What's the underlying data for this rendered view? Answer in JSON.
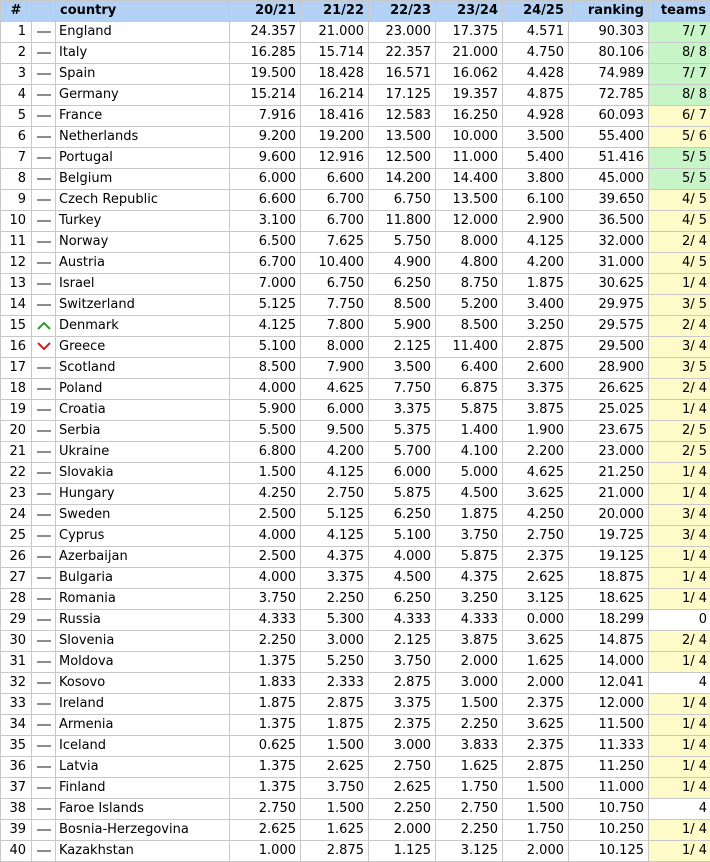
{
  "headers": {
    "num": "#",
    "country": "country",
    "s1": "20/21",
    "s2": "21/22",
    "s3": "22/23",
    "s4": "23/24",
    "s5": "24/25",
    "ranking": "ranking",
    "teams": "teams"
  },
  "colors": {
    "header_bg": "#b3d1f4",
    "teams_green": "#c8f5c8",
    "teams_yellow": "#fffbc8",
    "trend_same": "#8c8c8c",
    "trend_up": "#2e9a2e",
    "trend_down": "#cc2222"
  },
  "rows": [
    {
      "num": "1",
      "trend": "same",
      "country": "England",
      "v": [
        "24.357",
        "21.000",
        "23.000",
        "17.375",
        "4.571"
      ],
      "ranking": "90.303",
      "teams": "7/ 7",
      "teams_color": "green"
    },
    {
      "num": "2",
      "trend": "same",
      "country": "Italy",
      "v": [
        "16.285",
        "15.714",
        "22.357",
        "21.000",
        "4.750"
      ],
      "ranking": "80.106",
      "teams": "8/ 8",
      "teams_color": "green"
    },
    {
      "num": "3",
      "trend": "same",
      "country": "Spain",
      "v": [
        "19.500",
        "18.428",
        "16.571",
        "16.062",
        "4.428"
      ],
      "ranking": "74.989",
      "teams": "7/ 7",
      "teams_color": "green"
    },
    {
      "num": "4",
      "trend": "same",
      "country": "Germany",
      "v": [
        "15.214",
        "16.214",
        "17.125",
        "19.357",
        "4.875"
      ],
      "ranking": "72.785",
      "teams": "8/ 8",
      "teams_color": "green"
    },
    {
      "num": "5",
      "trend": "same",
      "country": "France",
      "v": [
        "7.916",
        "18.416",
        "12.583",
        "16.250",
        "4.928"
      ],
      "ranking": "60.093",
      "teams": "6/ 7",
      "teams_color": "yellow"
    },
    {
      "num": "6",
      "trend": "same",
      "country": "Netherlands",
      "v": [
        "9.200",
        "19.200",
        "13.500",
        "10.000",
        "3.500"
      ],
      "ranking": "55.400",
      "teams": "5/ 6",
      "teams_color": "yellow"
    },
    {
      "num": "7",
      "trend": "same",
      "country": "Portugal",
      "v": [
        "9.600",
        "12.916",
        "12.500",
        "11.000",
        "5.400"
      ],
      "ranking": "51.416",
      "teams": "5/ 5",
      "teams_color": "green"
    },
    {
      "num": "8",
      "trend": "same",
      "country": "Belgium",
      "v": [
        "6.000",
        "6.600",
        "14.200",
        "14.400",
        "3.800"
      ],
      "ranking": "45.000",
      "teams": "5/ 5",
      "teams_color": "green"
    },
    {
      "num": "9",
      "trend": "same",
      "country": "Czech Republic",
      "v": [
        "6.600",
        "6.700",
        "6.750",
        "13.500",
        "6.100"
      ],
      "ranking": "39.650",
      "teams": "4/ 5",
      "teams_color": "yellow"
    },
    {
      "num": "10",
      "trend": "same",
      "country": "Turkey",
      "v": [
        "3.100",
        "6.700",
        "11.800",
        "12.000",
        "2.900"
      ],
      "ranking": "36.500",
      "teams": "4/ 5",
      "teams_color": "yellow"
    },
    {
      "num": "11",
      "trend": "same",
      "country": "Norway",
      "v": [
        "6.500",
        "7.625",
        "5.750",
        "8.000",
        "4.125"
      ],
      "ranking": "32.000",
      "teams": "2/ 4",
      "teams_color": "yellow"
    },
    {
      "num": "12",
      "trend": "same",
      "country": "Austria",
      "v": [
        "6.700",
        "10.400",
        "4.900",
        "4.800",
        "4.200"
      ],
      "ranking": "31.000",
      "teams": "4/ 5",
      "teams_color": "yellow"
    },
    {
      "num": "13",
      "trend": "same",
      "country": "Israel",
      "v": [
        "7.000",
        "6.750",
        "6.250",
        "8.750",
        "1.875"
      ],
      "ranking": "30.625",
      "teams": "1/ 4",
      "teams_color": "yellow"
    },
    {
      "num": "14",
      "trend": "same",
      "country": "Switzerland",
      "v": [
        "5.125",
        "7.750",
        "8.500",
        "5.200",
        "3.400"
      ],
      "ranking": "29.975",
      "teams": "3/ 5",
      "teams_color": "yellow"
    },
    {
      "num": "15",
      "trend": "up",
      "country": "Denmark",
      "v": [
        "4.125",
        "7.800",
        "5.900",
        "8.500",
        "3.250"
      ],
      "ranking": "29.575",
      "teams": "2/ 4",
      "teams_color": "yellow"
    },
    {
      "num": "16",
      "trend": "down",
      "country": "Greece",
      "v": [
        "5.100",
        "8.000",
        "2.125",
        "11.400",
        "2.875"
      ],
      "ranking": "29.500",
      "teams": "3/ 4",
      "teams_color": "yellow"
    },
    {
      "num": "17",
      "trend": "same",
      "country": "Scotland",
      "v": [
        "8.500",
        "7.900",
        "3.500",
        "6.400",
        "2.600"
      ],
      "ranking": "28.900",
      "teams": "3/ 5",
      "teams_color": "yellow"
    },
    {
      "num": "18",
      "trend": "same",
      "country": "Poland",
      "v": [
        "4.000",
        "4.625",
        "7.750",
        "6.875",
        "3.375"
      ],
      "ranking": "26.625",
      "teams": "2/ 4",
      "teams_color": "yellow"
    },
    {
      "num": "19",
      "trend": "same",
      "country": "Croatia",
      "v": [
        "5.900",
        "6.000",
        "3.375",
        "5.875",
        "3.875"
      ],
      "ranking": "25.025",
      "teams": "1/ 4",
      "teams_color": "yellow"
    },
    {
      "num": "20",
      "trend": "same",
      "country": "Serbia",
      "v": [
        "5.500",
        "9.500",
        "5.375",
        "1.400",
        "1.900"
      ],
      "ranking": "23.675",
      "teams": "2/ 5",
      "teams_color": "yellow"
    },
    {
      "num": "21",
      "trend": "same",
      "country": "Ukraine",
      "v": [
        "6.800",
        "4.200",
        "5.700",
        "4.100",
        "2.200"
      ],
      "ranking": "23.000",
      "teams": "2/ 5",
      "teams_color": "yellow"
    },
    {
      "num": "22",
      "trend": "same",
      "country": "Slovakia",
      "v": [
        "1.500",
        "4.125",
        "6.000",
        "5.000",
        "4.625"
      ],
      "ranking": "21.250",
      "teams": "1/ 4",
      "teams_color": "yellow"
    },
    {
      "num": "23",
      "trend": "same",
      "country": "Hungary",
      "v": [
        "4.250",
        "2.750",
        "5.875",
        "4.500",
        "3.625"
      ],
      "ranking": "21.000",
      "teams": "1/ 4",
      "teams_color": "yellow"
    },
    {
      "num": "24",
      "trend": "same",
      "country": "Sweden",
      "v": [
        "2.500",
        "5.125",
        "6.250",
        "1.875",
        "4.250"
      ],
      "ranking": "20.000",
      "teams": "3/ 4",
      "teams_color": "yellow"
    },
    {
      "num": "25",
      "trend": "same",
      "country": "Cyprus",
      "v": [
        "4.000",
        "4.125",
        "5.100",
        "3.750",
        "2.750"
      ],
      "ranking": "19.725",
      "teams": "3/ 4",
      "teams_color": "yellow"
    },
    {
      "num": "26",
      "trend": "same",
      "country": "Azerbaijan",
      "v": [
        "2.500",
        "4.375",
        "4.000",
        "5.875",
        "2.375"
      ],
      "ranking": "19.125",
      "teams": "1/ 4",
      "teams_color": "yellow"
    },
    {
      "num": "27",
      "trend": "same",
      "country": "Bulgaria",
      "v": [
        "4.000",
        "3.375",
        "4.500",
        "4.375",
        "2.625"
      ],
      "ranking": "18.875",
      "teams": "1/ 4",
      "teams_color": "yellow"
    },
    {
      "num": "28",
      "trend": "same",
      "country": "Romania",
      "v": [
        "3.750",
        "2.250",
        "6.250",
        "3.250",
        "3.125"
      ],
      "ranking": "18.625",
      "teams": "1/ 4",
      "teams_color": "yellow"
    },
    {
      "num": "29",
      "trend": "same",
      "country": "Russia",
      "v": [
        "4.333",
        "5.300",
        "4.333",
        "4.333",
        "0.000"
      ],
      "ranking": "18.299",
      "teams": "0",
      "teams_color": "white"
    },
    {
      "num": "30",
      "trend": "same",
      "country": "Slovenia",
      "v": [
        "2.250",
        "3.000",
        "2.125",
        "3.875",
        "3.625"
      ],
      "ranking": "14.875",
      "teams": "2/ 4",
      "teams_color": "yellow"
    },
    {
      "num": "31",
      "trend": "same",
      "country": "Moldova",
      "v": [
        "1.375",
        "5.250",
        "3.750",
        "2.000",
        "1.625"
      ],
      "ranking": "14.000",
      "teams": "1/ 4",
      "teams_color": "yellow"
    },
    {
      "num": "32",
      "trend": "same",
      "country": "Kosovo",
      "v": [
        "1.833",
        "2.333",
        "2.875",
        "3.000",
        "2.000"
      ],
      "ranking": "12.041",
      "teams": "4",
      "teams_color": "white"
    },
    {
      "num": "33",
      "trend": "same",
      "country": "Ireland",
      "v": [
        "1.875",
        "2.875",
        "3.375",
        "1.500",
        "2.375"
      ],
      "ranking": "12.000",
      "teams": "1/ 4",
      "teams_color": "yellow"
    },
    {
      "num": "34",
      "trend": "same",
      "country": "Armenia",
      "v": [
        "1.375",
        "1.875",
        "2.375",
        "2.250",
        "3.625"
      ],
      "ranking": "11.500",
      "teams": "1/ 4",
      "teams_color": "yellow"
    },
    {
      "num": "35",
      "trend": "same",
      "country": "Iceland",
      "v": [
        "0.625",
        "1.500",
        "3.000",
        "3.833",
        "2.375"
      ],
      "ranking": "11.333",
      "teams": "1/ 4",
      "teams_color": "yellow"
    },
    {
      "num": "36",
      "trend": "same",
      "country": "Latvia",
      "v": [
        "1.375",
        "2.625",
        "2.750",
        "1.625",
        "2.875"
      ],
      "ranking": "11.250",
      "teams": "1/ 4",
      "teams_color": "yellow"
    },
    {
      "num": "37",
      "trend": "same",
      "country": "Finland",
      "v": [
        "1.375",
        "3.750",
        "2.625",
        "1.750",
        "1.500"
      ],
      "ranking": "11.000",
      "teams": "1/ 4",
      "teams_color": "yellow"
    },
    {
      "num": "38",
      "trend": "same",
      "country": "Faroe Islands",
      "v": [
        "2.750",
        "1.500",
        "2.250",
        "2.750",
        "1.500"
      ],
      "ranking": "10.750",
      "teams": "4",
      "teams_color": "white"
    },
    {
      "num": "39",
      "trend": "same",
      "country": "Bosnia-Herzegovina",
      "v": [
        "2.625",
        "1.625",
        "2.000",
        "2.250",
        "1.750"
      ],
      "ranking": "10.250",
      "teams": "1/ 4",
      "teams_color": "yellow"
    },
    {
      "num": "40",
      "trend": "same",
      "country": "Kazakhstan",
      "v": [
        "1.000",
        "2.875",
        "1.125",
        "3.125",
        "2.000"
      ],
      "ranking": "10.125",
      "teams": "1/ 4",
      "teams_color": "yellow"
    }
  ]
}
